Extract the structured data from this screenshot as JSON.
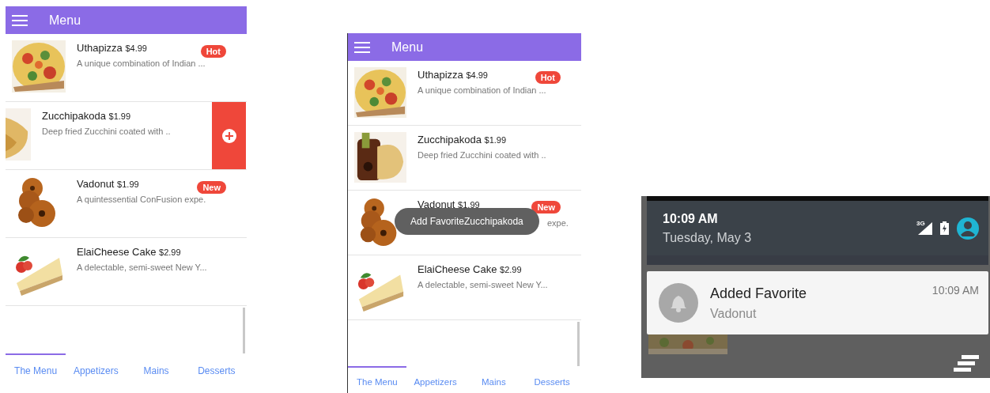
{
  "screens": [
    {
      "kind": "menu-list",
      "title": "Menu",
      "items": [
        {
          "name": "Uthapizza",
          "price": "$4.99",
          "description": "A unique combination of Indian ...",
          "badge": "Hot",
          "swiped": false
        },
        {
          "name": "Zucchipakoda",
          "price": "$1.99",
          "description": "Deep fried Zucchini coated with ..",
          "swiped": true
        },
        {
          "name": "Vadonut",
          "price": "$1.99",
          "description": "A quintessential ConFusion expe.",
          "badge": "New",
          "swiped": false
        },
        {
          "name": "ElaiCheese Cake",
          "price": "$2.99",
          "description": "A delectable, semi-sweet New Y...",
          "swiped": false
        }
      ],
      "tabs": [
        {
          "label": "The Menu",
          "selected": true
        },
        {
          "label": "Appetizers",
          "selected": false
        },
        {
          "label": "Mains",
          "selected": false
        },
        {
          "label": "Desserts",
          "selected": false
        }
      ]
    },
    {
      "kind": "menu-list",
      "title": "Menu",
      "items": [
        {
          "name": "Uthapizza",
          "price": "$4.99",
          "description": "A unique combination of Indian ...",
          "badge": "Hot",
          "swiped": false
        },
        {
          "name": "Zucchipakoda",
          "price": "$1.99",
          "description": "Deep fried Zucchini coated with ..",
          "swiped": false
        },
        {
          "name": "Vadonut",
          "price": "$1.99",
          "description": "expe.",
          "badge": "New",
          "swiped": false,
          "under_toast": true
        },
        {
          "name": "ElaiCheese Cake",
          "price": "$2.99",
          "description": "A delectable, semi-sweet New Y...",
          "swiped": false
        }
      ],
      "toast": "Add FavoriteZucchipakoda",
      "tabs": [
        {
          "label": "The Menu",
          "selected": true
        },
        {
          "label": "Appetizers",
          "selected": false
        },
        {
          "label": "Mains",
          "selected": false
        },
        {
          "label": "Desserts",
          "selected": false
        }
      ]
    },
    {
      "kind": "notification-shade",
      "time": "10:09 AM",
      "date": "Tuesday, May 3",
      "network": "3G",
      "notification": {
        "title": "Added Favorite",
        "text": "Vadonut",
        "time": "10:09 AM"
      }
    }
  ]
}
